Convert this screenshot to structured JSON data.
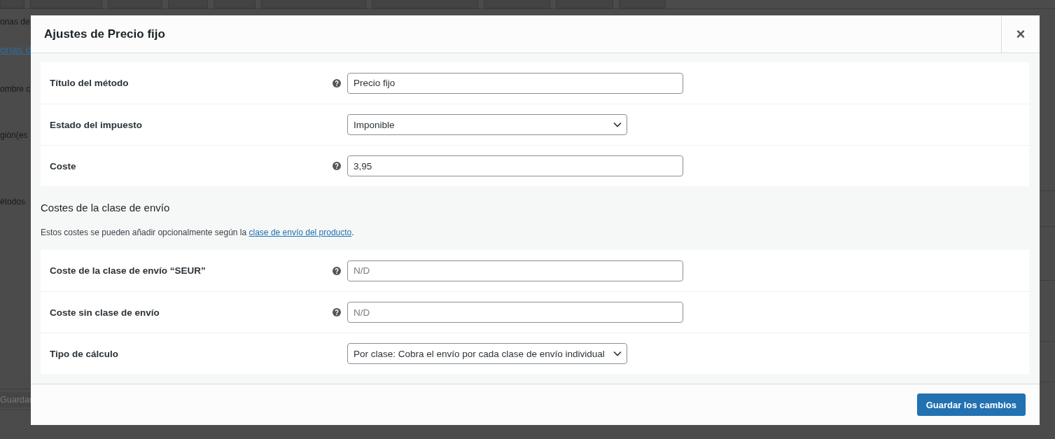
{
  "background": {
    "fragments": [
      {
        "kind": "text",
        "text": "onas de"
      },
      {
        "kind": "link",
        "text": "onas d"
      },
      {
        "kind": "text",
        "text": "ombre c"
      },
      {
        "kind": "text",
        "text": "gión(es"
      },
      {
        "kind": "text",
        "text": "étodos"
      }
    ],
    "save_button": "Guardar"
  },
  "modal": {
    "title": "Ajustes de Precio fijo",
    "close": "×",
    "sections": [
      {
        "rows": [
          {
            "label": "Título del método",
            "kind": "text",
            "help": true,
            "value": "Precio fijo"
          },
          {
            "label": "Estado del impuesto",
            "kind": "select",
            "help": false,
            "value": "Imponible"
          },
          {
            "label": "Coste",
            "kind": "text",
            "help": true,
            "value": "3,95"
          }
        ]
      },
      {
        "heading": "Costes de la clase de envío",
        "description": {
          "text": "Estos costes se pueden añadir opcionalmente según la ",
          "link": "clase de envío del producto",
          "tail": "."
        },
        "rows": [
          {
            "label": "Coste de la clase de envío “SEUR”",
            "kind": "text",
            "help": true,
            "placeholder": "N/D"
          },
          {
            "label": "Coste sin clase de envío",
            "kind": "text",
            "help": true,
            "placeholder": "N/D"
          },
          {
            "label": "Tipo de cálculo",
            "kind": "select",
            "help": false,
            "value": "Por clase: Cobra el envío por cada clase de envío individual"
          }
        ]
      }
    ],
    "save_button": "Guardar los cambios"
  }
}
